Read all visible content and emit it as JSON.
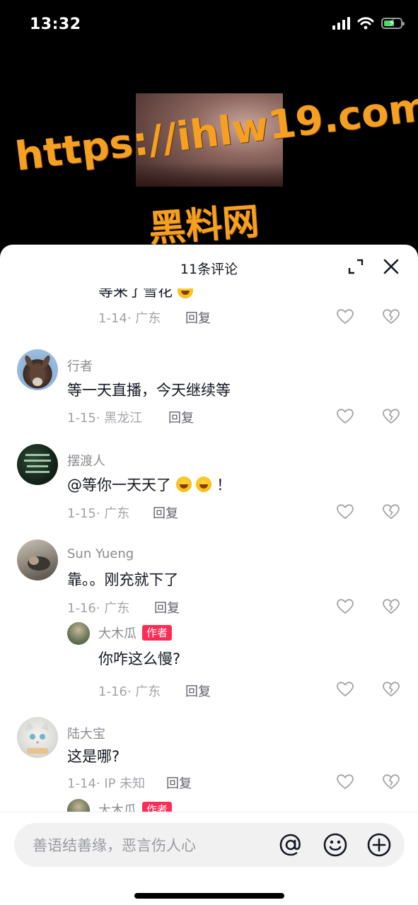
{
  "status_bar": {
    "time": "13:32"
  },
  "video": {
    "watermark_url": "https://ihlw19.com",
    "watermark_name": "黑料网"
  },
  "comments_panel": {
    "title": "11条评论",
    "comments": [
      {
        "username": "",
        "text": "等来了雪花",
        "date_location": "1-14· 广东",
        "reply_label": "回复"
      },
      {
        "username": "行者",
        "text": "等一天直播，今天继续等",
        "date_location": "1-15· 黑龙江",
        "reply_label": "回复"
      },
      {
        "username": "摆渡人",
        "text": "@等你一天天了",
        "text_suffix": "！",
        "date_location": "1-15· 广东",
        "reply_label": "回复"
      },
      {
        "username": "Sun Yueng",
        "text": "靠。。刚充就下了",
        "date_location": "1-16· 广东",
        "reply_label": "回复"
      },
      {
        "username": "大木瓜",
        "badge": "作者",
        "text": "你咋这么慢?",
        "date_location": "1-16· 广东",
        "reply_label": "回复"
      },
      {
        "username": "陆大宝",
        "text": "这是哪?",
        "date_location": "1-14· IP 未知",
        "reply_label": "回复"
      },
      {
        "username": "大木瓜",
        "badge": "作者"
      }
    ]
  },
  "input_bar": {
    "placeholder": "善语结善缘，恶言伤人心"
  },
  "icons": [
    "expand-icon",
    "close-icon",
    "heart-icon",
    "dislike-heart-icon",
    "at-icon",
    "smiley-icon",
    "plus-circle-icon"
  ],
  "colors": {
    "author_badge": "#fe2c55",
    "watermark": "#f6a021"
  }
}
